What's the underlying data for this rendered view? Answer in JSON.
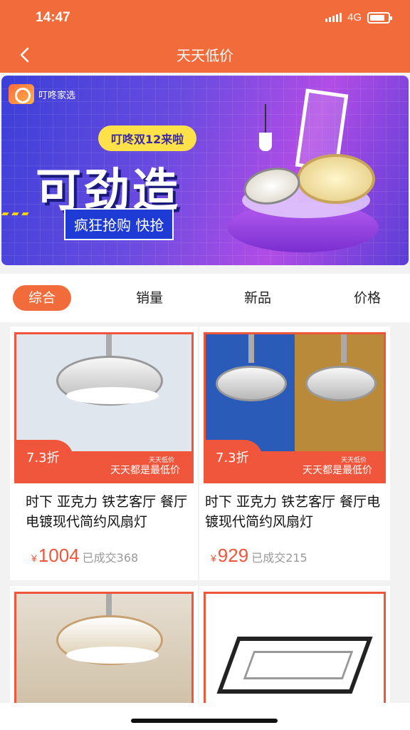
{
  "status_bar": {
    "time": "14:47",
    "network": "4G"
  },
  "navbar": {
    "title": "天天低价"
  },
  "banner": {
    "brand": "叮咚家选",
    "promo": "叮咚双12来啦",
    "headline": "可劲造",
    "subline": "疯狂抢购 快抢"
  },
  "tabs": [
    {
      "label": "综合",
      "active": true
    },
    {
      "label": "销量",
      "active": false
    },
    {
      "label": "新品",
      "active": false
    },
    {
      "label": "价格",
      "active": false
    }
  ],
  "products": [
    {
      "name": "时下 亚克力 铁艺客厅 餐厅电镀现代简约风扇灯",
      "discount": "7.3折",
      "banner_top": "天天低价",
      "banner_text": "天天都是最低价",
      "currency": "¥",
      "price": "1004",
      "sold": "已成交368"
    },
    {
      "name": "时下 亚克力 铁艺客厅 餐厅电镀现代简约风扇灯",
      "discount": "7.3折",
      "banner_top": "天天低价",
      "banner_text": "天天都是最低价",
      "currency": "¥",
      "price": "929",
      "sold": "已成交215"
    }
  ],
  "colors": {
    "accent": "#f26b3a",
    "price": "#f0563c"
  }
}
